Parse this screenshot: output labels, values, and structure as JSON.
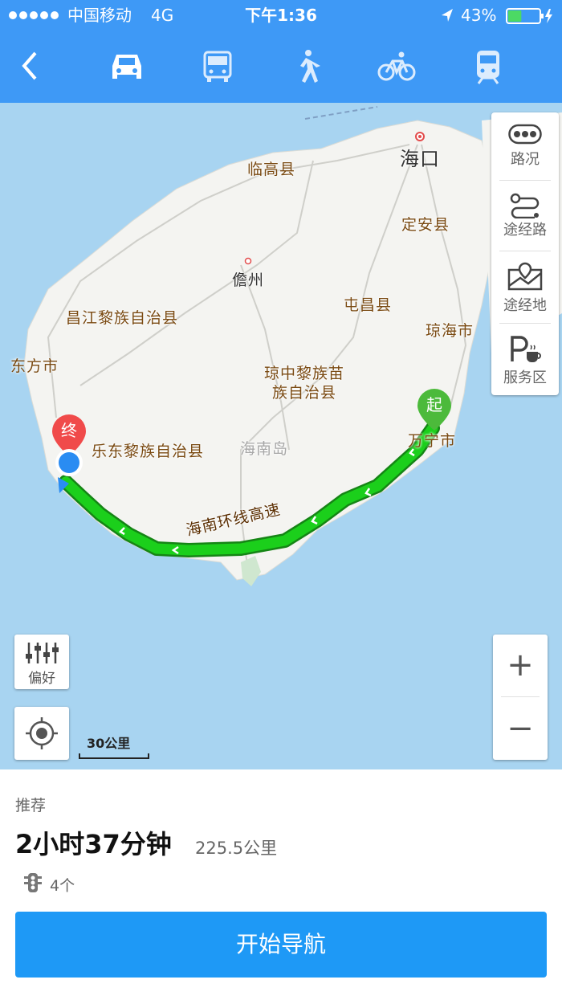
{
  "status_bar": {
    "carrier": "中国移动",
    "network": "4G",
    "time": "下午1:36",
    "battery": "43%",
    "battery_level": 0.43
  },
  "header": {
    "back_icon": "chevron-left-icon",
    "modes": [
      {
        "name": "car",
        "icon": "car-icon",
        "selected": true
      },
      {
        "name": "bus",
        "icon": "bus-icon",
        "selected": false
      },
      {
        "name": "walk",
        "icon": "walk-icon",
        "selected": false
      },
      {
        "name": "bike",
        "icon": "bike-icon",
        "selected": false
      },
      {
        "name": "train",
        "icon": "train-icon",
        "selected": false
      }
    ]
  },
  "map": {
    "cities": {
      "haikou": "海口",
      "lingao": "临高县",
      "dingan": "定安县",
      "danzhou": "儋州",
      "tunchang": "屯昌县",
      "changjiang": "昌江黎族自治县",
      "qionghai": "琼海市",
      "dongfang": "东方市",
      "qiongzhong_1": "琼中黎族苗",
      "qiongzhong_2": "族自治县",
      "ledong": "乐东黎族自治县",
      "hainan_island": "海南岛",
      "wanning": "万宁市"
    },
    "route_label": "海南环线高速",
    "start_marker": "起",
    "end_marker": "终",
    "scale": "30公里",
    "colors": {
      "sea": "#a8d4f1",
      "land": "#f4f4f1",
      "route": "#1bb51b",
      "start": "#4cba3b",
      "end": "#f04a4a",
      "location": "#2a8cf2"
    }
  },
  "side_panel": {
    "traffic": "路况",
    "waypoint_route": "途经路",
    "waypoint_place": "途经地",
    "service_area": "服务区"
  },
  "controls": {
    "preference": "偏好",
    "zoom_in": "+",
    "zoom_out": "−"
  },
  "summary": {
    "tag": "推荐",
    "duration": "2小时37分钟",
    "distance": "225.5公里",
    "traffic_lights": "4个",
    "start_nav": "开始导航"
  }
}
